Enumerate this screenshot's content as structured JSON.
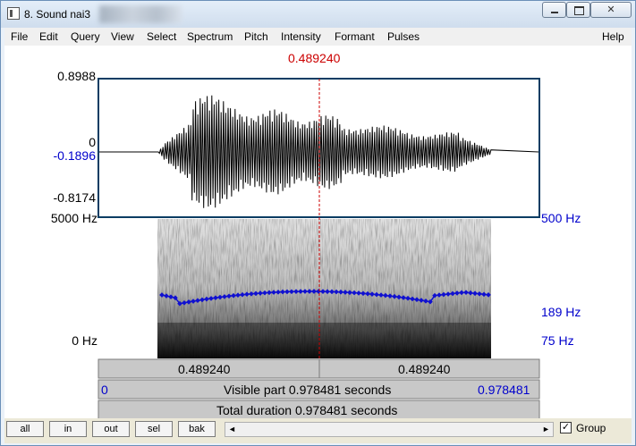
{
  "window": {
    "title": "8. Sound nai3",
    "btn_min": "",
    "btn_max": "",
    "btn_close": "✕"
  },
  "menu": [
    "File",
    "Edit",
    "Query",
    "View",
    "Select",
    "Spectrum",
    "Pitch",
    "Intensity",
    "Formant",
    "Pulses",
    "Help"
  ],
  "cursor_time": "0.489240",
  "waveform": {
    "max_label": "0.8988",
    "zero_label": "0",
    "cursor_amp_label": "-0.1896",
    "min_label": "-0.8174"
  },
  "spectrogram": {
    "top_freq": "5000 Hz",
    "bottom_freq": "0 Hz",
    "pitch_top": "500 Hz",
    "pitch_mid": "189 Hz",
    "pitch_bottom": "75 Hz"
  },
  "timebar": {
    "left_part": "0.489240",
    "right_part": "0.489240",
    "visible_start": "0",
    "visible_text": "Visible part 0.978481 seconds",
    "visible_end": "0.978481",
    "total_text": "Total duration 0.978481 seconds"
  },
  "buttons": {
    "all": "all",
    "in": "in",
    "out": "out",
    "sel": "sel",
    "bak": "bak"
  },
  "scroll": {
    "left_arrow": "◄",
    "right_arrow": "►"
  },
  "group": {
    "label": "Group",
    "checked": true,
    "check_mark": "✓"
  },
  "colors": {
    "cursor": "#cc0000",
    "pitch": "#1010d0",
    "accent_blue": "#0000cc"
  }
}
